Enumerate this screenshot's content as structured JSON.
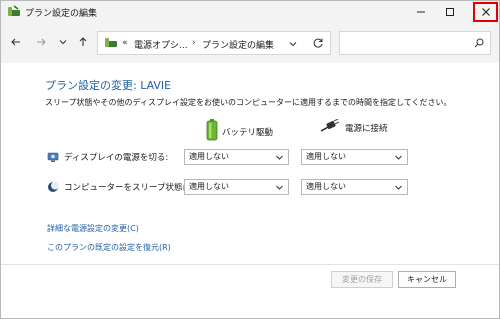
{
  "window": {
    "title": "プラン設定の編集"
  },
  "address": {
    "overflow": "«",
    "segments": [
      "電源オプシ...",
      "プラン設定の編集"
    ],
    "separator": "›"
  },
  "search": {
    "placeholder": ""
  },
  "content": {
    "heading": "プラン設定の変更: LAVIE",
    "description": "スリープ状態やその他のディスプレイ設定をお使いのコンピューターに適用するまでの時間を指定してください。",
    "columns": {
      "battery": "バッテリ駆動",
      "plugged": "電源に接続"
    },
    "rows": [
      {
        "label": "ディスプレイの電源を切る:",
        "battery_value": "適用しない",
        "plugged_value": "適用しない"
      },
      {
        "label": "コンピューターをスリープ状態にする:",
        "battery_value": "適用しない",
        "plugged_value": "適用しない"
      }
    ],
    "links": {
      "advanced": "詳細な電源設定の変更(C)",
      "restore": "このプランの既定の設定を復元(R)"
    }
  },
  "buttons": {
    "save": "変更の保存",
    "cancel": "キャンセル"
  },
  "colors": {
    "link": "#1f5ea8",
    "close_highlight": "#e00000"
  }
}
